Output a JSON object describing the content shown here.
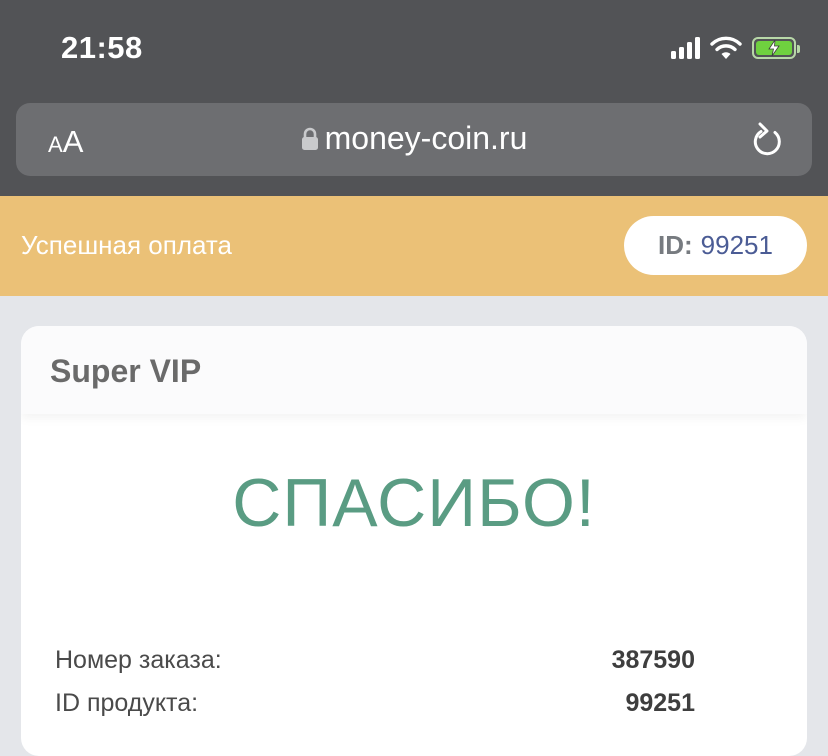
{
  "status_bar": {
    "time": "21:58"
  },
  "browser": {
    "text_size_small": "A",
    "text_size_big": "A",
    "url": "money-coin.ru"
  },
  "banner": {
    "title": "Успешная оплата",
    "id_label": "ID:",
    "id_value": "99251"
  },
  "card": {
    "title": "Super VIP",
    "thanks": "СПАСИБО!",
    "rows": [
      {
        "label": "Номер заказа:",
        "value": "387590"
      },
      {
        "label": "ID продукта:",
        "value": "99251"
      }
    ]
  },
  "colors": {
    "banner_bg": "#ebc177",
    "thanks_text": "#5a9c83",
    "id_value": "#4b5c95"
  },
  "icons": [
    "signal-icon",
    "wifi-icon",
    "battery-charging-icon",
    "lock-icon",
    "reload-icon"
  ]
}
